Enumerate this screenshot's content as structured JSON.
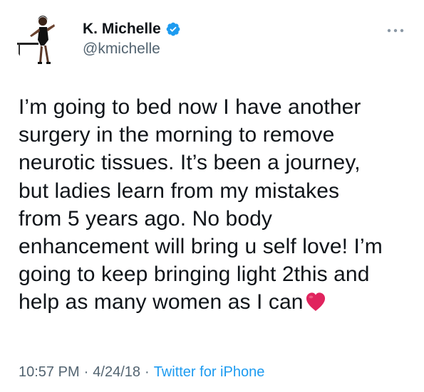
{
  "user": {
    "display_name": "K. Michelle",
    "handle": "@kmichelle",
    "verified": true,
    "avatar_icon": "avatar-dancer"
  },
  "tweet": {
    "text": "I’m going to bed now I have another\nsurgery in the morning to remove\nneurotic tissues. It’s been a journey,\nbut ladies learn from my mistakes\nfrom 5 years ago. No body\nenhancement will bring u self love! I’m\ngoing to keep bringing light 2this and\nhelp as many women as I can",
    "emoji": "red-heart"
  },
  "meta": {
    "time": "10:57 PM",
    "separator": "·",
    "date": "4/24/18",
    "source": "Twitter for iPhone"
  },
  "colors": {
    "text_primary": "#0f1419",
    "text_secondary": "#536471",
    "link": "#1d9bf0",
    "verified_badge": "#1d9bf0",
    "heart": "#e0245e"
  }
}
